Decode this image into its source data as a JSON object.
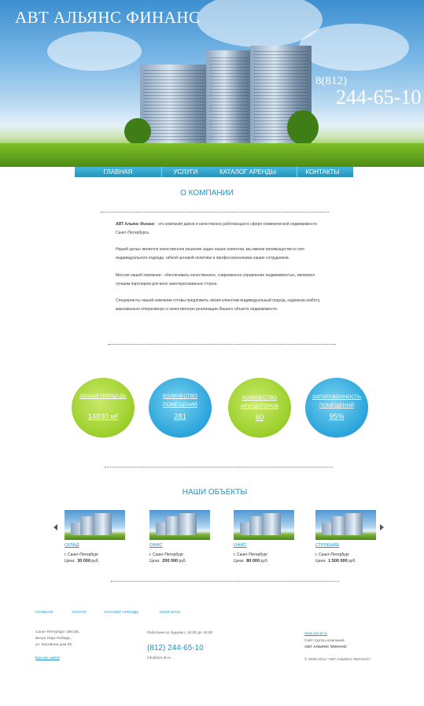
{
  "header": {
    "logo": "АВТ АЛЬЯНС ФИНАНС",
    "phone_code": "8(812)",
    "phone_number": "244-65-10"
  },
  "nav": {
    "items": [
      {
        "label": "ГЛАВНАЯ"
      },
      {
        "label": "УСЛУГИ"
      },
      {
        "label": "КАТАЛОГ АРЕНДЫ"
      },
      {
        "label": "КОНТАКТЫ"
      }
    ]
  },
  "about": {
    "title": "О КОМПАНИИ",
    "p1_bold": "АВТ Альянс Финанс",
    "p1_rest": " - это компания давно и качественно работающая в сфере коммерческой недвижимости Санкт-Петербурга.",
    "p2": "Нашей целью является качественное решение задач наших клиентов, мы имеем преимущество в счет индивидуального подхода, гибкой ценовой политики и профессионализма наших сотрудников.",
    "p3": "Миссия нашей компании - обеспечивать качественное, современное управление недвижимостью, являемся лучшим партнером для всех заинтересованных сторон.",
    "p4": "Специалисты нашей компании готовы предложить своим клиентам индивидуальный подход, надежную работу, максимально оперативную и качественную реализацию Вашего объекта недвижимости."
  },
  "stats": [
    {
      "label": "ОБЩАЯ ПЛОЩАДЬ",
      "value": "14830 м²",
      "color": "#9ed12e"
    },
    {
      "label": "КОЛИЧЕСТВО ПОМЕЩЕНИЙ",
      "value": "281",
      "color": "#2fa7dd"
    },
    {
      "label": "КОЛИЧЕСТВО АРЕНДАТОРОВ",
      "value": "60",
      "color": "#9ed12e"
    },
    {
      "label": "ЗАГОРУЖЕННОСТЬ ПОМЕЩЕНИЙ",
      "value": "95%",
      "color": "#2fa7dd"
    }
  ],
  "objects": {
    "title": "НАШИ ОБЪЕКТЫ",
    "price_label": "Цена:",
    "currency": "руб.",
    "items": [
      {
        "name": "СКЛАД",
        "city": "г. Санкт-Петербург",
        "price": "30 000"
      },
      {
        "name": "ОФИС",
        "city": "г. Санкт-Петербург",
        "price": "200 000"
      },
      {
        "name": "ОФИС",
        "city": "г. Санкт-Петербург",
        "price": "80 000"
      },
      {
        "name": "СТРОЕНИЕ",
        "city": "г. Санкт-Петербург",
        "price": "1 500 000"
      }
    ]
  },
  "footer": {
    "nav": [
      {
        "label": "ГЛАВНАЯ"
      },
      {
        "label": "УСЛУГИ"
      },
      {
        "label": "КАТАЛОГ АРЕНДЫ"
      },
      {
        "label": "КОНТАКТЫ"
      }
    ],
    "address": [
      "Санкт-Петербург 196105,",
      "метро Парк Победы,",
      "ул. Басейная дом 38"
    ],
    "map_link": "Как нас найти",
    "hours": "Работаем по будням с 10.00 до 18.00",
    "phone": "(812) 244-65-10",
    "email": "info@avt-af.ru",
    "site": "www.avt-af.ru",
    "group": "Сайт группы компаний",
    "group_name": "АВТ АЛЬЯНС ФИНАНС",
    "copyright": "© 2000-2012 \"АВТ АЛЬЯНС ФИНАНС\""
  }
}
